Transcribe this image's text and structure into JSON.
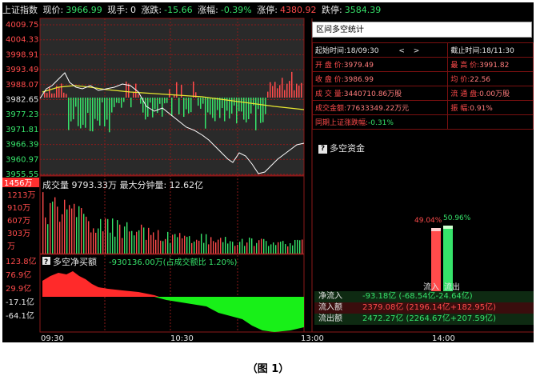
{
  "topbar": {
    "index_name": "上证指数",
    "price_label": "现价:",
    "price_value": "3966.99",
    "volume_label": "现手:",
    "volume_value": "0",
    "change_label": "涨跌:",
    "change_value": "-15.66",
    "pct_label": "涨幅:",
    "pct_value": "-0.39%",
    "limit_up_label": "涨停:",
    "limit_up_value": "4380.92",
    "limit_down_label": "跌停:",
    "limit_down_value": "3584.39"
  },
  "price_axis": [
    "4009.75",
    "4004.33",
    "3998.91",
    "3993.49",
    "3988.07",
    "3982.65",
    "3977.23",
    "3971.81",
    "3966.39",
    "3960.97",
    "3955.55"
  ],
  "volume_panel": {
    "title": "成交量 9793.33万  最大分钟量: 12.62亿",
    "axis_top_badge": "1456万",
    "axis": [
      "1213万",
      "910万",
      "607万",
      "303万",
      "万"
    ]
  },
  "flow_panel": {
    "title": "多空净买额",
    "title_value": "-930136.00万(占成交额比 1.20%)",
    "axis": [
      "123.8亿",
      "76.9亿",
      "29.9亿",
      "-17.1亿",
      "-64.1亿"
    ]
  },
  "time_axis": [
    "09:30",
    "10:30",
    "13:00",
    "14:00"
  ],
  "stats": {
    "header": "区间多空统计",
    "start_label": "起始时间:",
    "start_value": "18/09:30",
    "nav_prev": "<",
    "nav_next": ">",
    "end_label": "截止时间:",
    "end_value": "18/11:30",
    "rows": [
      {
        "l1": "开 盘 价:",
        "v1": "3979.49",
        "l2": "最 高 价:",
        "v2": "3991.82"
      },
      {
        "l1": "收 盘 价:",
        "v1": "3986.99",
        "l2": "均    价:",
        "v2": "22.56"
      },
      {
        "l1": "成 交 量:",
        "v1": "3440710.86万股",
        "l2": "流 通 盘:",
        "v2": "0.00万股"
      },
      {
        "l1": "成交金额:",
        "v1": "77633349.22万元",
        "l2": "振    幅:",
        "v2": "0.91%"
      }
    ],
    "same_period_label": "同期上证涨跌幅:",
    "same_period_value": "-0.31%"
  },
  "duokong": {
    "title": "多空资金",
    "inflow_pct": "49.04%",
    "outflow_pct": "50.96%",
    "inflow_label": "流入",
    "outflow_label": "流出",
    "net_inflow_label": "净流入",
    "net_inflow_value": "-93.18亿 (-68.54亿-24.64亿)",
    "inflow_amount_label": "流入额",
    "inflow_amount_value": "2379.08亿 (2196.14亿+182.95亿)",
    "outflow_amount_label": "流出额",
    "outflow_amount_value": "2472.27亿 (2264.67亿+207.59亿)"
  },
  "caption": "（图 1）",
  "colors": {
    "background": "#000000",
    "up": "#ff4b4b",
    "down": "#36e36a",
    "price_line": "#ffffff",
    "avg_line": "#e8e830",
    "grid": "#8b1a1a"
  }
}
